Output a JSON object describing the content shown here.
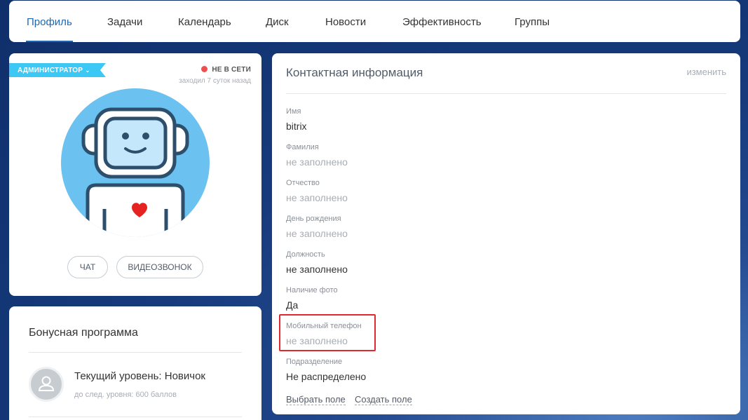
{
  "topnav": {
    "tabs": [
      {
        "label": "Профиль",
        "active": true
      },
      {
        "label": "Задачи"
      },
      {
        "label": "Календарь"
      },
      {
        "label": "Диск"
      },
      {
        "label": "Новости"
      },
      {
        "label": "Эффективность"
      },
      {
        "label": "Группы"
      }
    ]
  },
  "profile": {
    "role": "АДМИНИСТРАТОР",
    "status": "НЕ В СЕТИ",
    "last_seen": "заходил 7 суток назад",
    "chat_label": "ЧАТ",
    "video_label": "ВИДЕОЗВОНОК",
    "colors": {
      "badge": "#3bc8f5",
      "avatar_bg": "#6bc1ef",
      "heart": "#e52320",
      "offline": "#f04e4e"
    }
  },
  "bonus": {
    "title": "Бонусная программа",
    "level": "Текущий уровень: Новичок",
    "next": "до след. уровня: 600 баллов"
  },
  "contact": {
    "title": "Контактная информация",
    "edit": "изменить",
    "fields": [
      {
        "label": "Имя",
        "value": "bitrix"
      },
      {
        "label": "Фамилия",
        "value": "не заполнено"
      },
      {
        "label": "Отчество",
        "value": "не заполнено"
      },
      {
        "label": "День рождения",
        "value": "не заполнено"
      },
      {
        "label": "Должность",
        "value": "не заполнено"
      },
      {
        "label": "Наличие фото",
        "value": "Да"
      },
      {
        "label": "Мобильный телефон",
        "value": "не заполнено"
      },
      {
        "label": "Подразделение",
        "value": "Не распределено"
      }
    ],
    "select_field": "Выбрать поле",
    "create_field": "Создать поле",
    "highlight_color": "#e0282e"
  }
}
